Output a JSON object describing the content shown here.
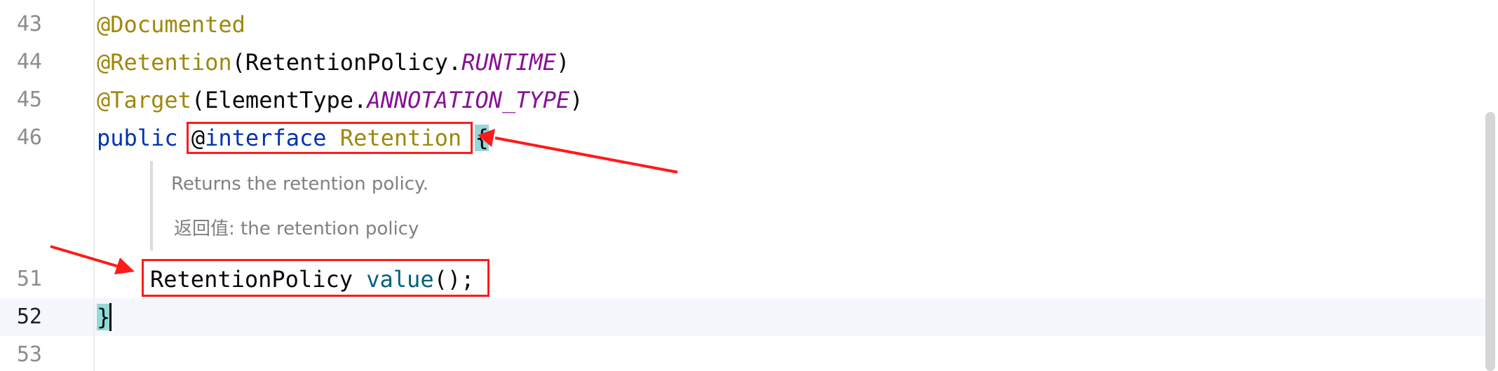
{
  "gutter": {
    "line_43": "43",
    "line_44": "44",
    "line_45": "45",
    "line_46": "46",
    "line_51": "51",
    "line_52": "52",
    "line_53": "53"
  },
  "code": {
    "l43_annotation": "@Documented",
    "l44_annotation": "@Retention",
    "l44_open": "(RetentionPolicy.",
    "l44_const": "RUNTIME",
    "l44_close": ")",
    "l45_annotation": "@Target",
    "l45_open": "(ElementType.",
    "l45_const": "ANNOTATION_TYPE",
    "l45_close": ")",
    "l46_public": "public",
    "l46_at": "@",
    "l46_interface": "interface",
    "l46_name": "Retention",
    "l46_brace": "{",
    "l51_type": "RetentionPolicy",
    "l51_method": "value",
    "l51_rest": "();",
    "l52_brace": "}"
  },
  "doc": {
    "summary": "Returns the retention policy.",
    "returns_label": "返回值:",
    "returns_text": "the retention policy"
  },
  "colors": {
    "annotation": "#9e880d",
    "enum_constant": "#871094",
    "keyword": "#0033b3",
    "method": "#00627a",
    "brace_highlight": "#93d9d9",
    "annotation_box": "#ff1a1a"
  }
}
